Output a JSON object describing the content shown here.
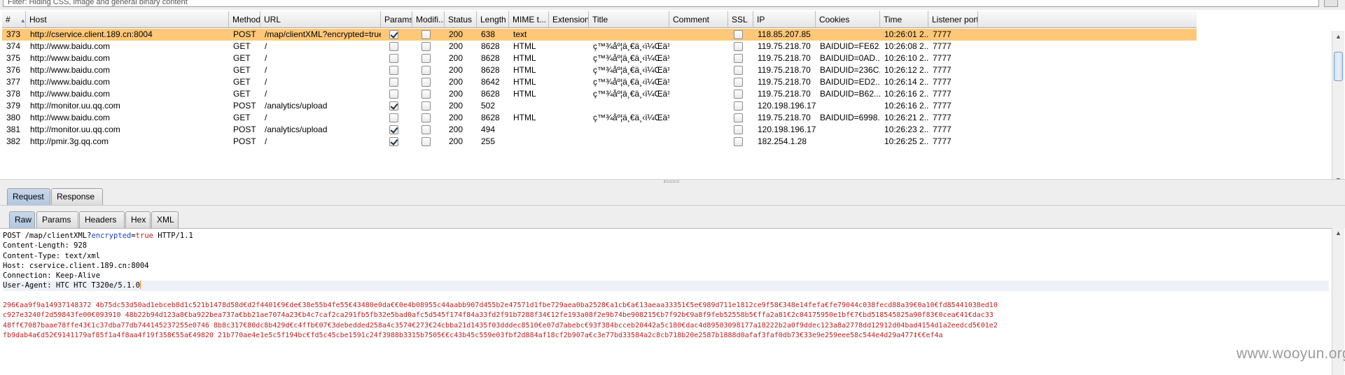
{
  "filter": {
    "text": "Filter: Hiding CSS, image and general binary content"
  },
  "columns": [
    {
      "key": "num",
      "label": "#"
    },
    {
      "key": "host",
      "label": "Host"
    },
    {
      "key": "method",
      "label": "Method"
    },
    {
      "key": "url",
      "label": "URL"
    },
    {
      "key": "params",
      "label": "Params"
    },
    {
      "key": "modified",
      "label": "Modifi..."
    },
    {
      "key": "status",
      "label": "Status"
    },
    {
      "key": "length",
      "label": "Length"
    },
    {
      "key": "mime",
      "label": "MIME t..."
    },
    {
      "key": "extension",
      "label": "Extension"
    },
    {
      "key": "title",
      "label": "Title"
    },
    {
      "key": "comment",
      "label": "Comment"
    },
    {
      "key": "ssl",
      "label": "SSL"
    },
    {
      "key": "ip",
      "label": "IP"
    },
    {
      "key": "cookies",
      "label": "Cookies"
    },
    {
      "key": "time",
      "label": "Time"
    },
    {
      "key": "port",
      "label": "Listener port"
    }
  ],
  "rows": [
    {
      "num": "373",
      "host": "http://cservice.client.189.cn:8004",
      "method": "POST",
      "url": "/map/clientXML?encrypted=true",
      "params": true,
      "modified": false,
      "status": "200",
      "length": "638",
      "mime": "text",
      "extension": "",
      "title": "",
      "comment": "",
      "ssl": false,
      "ip": "118.85.207.85",
      "cookies": "",
      "time": "10:26:01 2...",
      "port": "7777",
      "selected": true
    },
    {
      "num": "374",
      "host": "http://www.baidu.com",
      "method": "GET",
      "url": "/",
      "params": false,
      "modified": false,
      "status": "200",
      "length": "8628",
      "mime": "HTML",
      "extension": "",
      "title": "ç™¾åº¦ä¸€ä¸‹ï¼Œä½ å°±...",
      "comment": "",
      "ssl": false,
      "ip": "119.75.218.70",
      "cookies": "BAIDUID=FE62...",
      "time": "10:26:08 2...",
      "port": "7777",
      "selected": false
    },
    {
      "num": "375",
      "host": "http://www.baidu.com",
      "method": "GET",
      "url": "/",
      "params": false,
      "modified": false,
      "status": "200",
      "length": "8628",
      "mime": "HTML",
      "extension": "",
      "title": "ç™¾åº¦ä¸€ä¸‹ï¼Œä½ å°±...",
      "comment": "",
      "ssl": false,
      "ip": "119.75.218.70",
      "cookies": "BAIDUID=0AD...",
      "time": "10:26:10 2...",
      "port": "7777",
      "selected": false
    },
    {
      "num": "376",
      "host": "http://www.baidu.com",
      "method": "GET",
      "url": "/",
      "params": false,
      "modified": false,
      "status": "200",
      "length": "8628",
      "mime": "HTML",
      "extension": "",
      "title": "ç™¾åº¦ä¸€ä¸‹ï¼Œä½ å°±...",
      "comment": "",
      "ssl": false,
      "ip": "119.75.218.70",
      "cookies": "BAIDUID=236C...",
      "time": "10:26:12 2...",
      "port": "7777",
      "selected": false
    },
    {
      "num": "377",
      "host": "http://www.baidu.com",
      "method": "GET",
      "url": "/",
      "params": false,
      "modified": false,
      "status": "200",
      "length": "8642",
      "mime": "HTML",
      "extension": "",
      "title": "ç™¾åº¦ä¸€ä¸‹ï¼Œä½ å°±...",
      "comment": "",
      "ssl": false,
      "ip": "119.75.218.70",
      "cookies": "BAIDUID=ED2...",
      "time": "10:26:14 2...",
      "port": "7777",
      "selected": false
    },
    {
      "num": "378",
      "host": "http://www.baidu.com",
      "method": "GET",
      "url": "/",
      "params": false,
      "modified": false,
      "status": "200",
      "length": "8628",
      "mime": "HTML",
      "extension": "",
      "title": "ç™¾åº¦ä¸€ä¸‹ï¼Œä½ å°±...",
      "comment": "",
      "ssl": false,
      "ip": "119.75.218.70",
      "cookies": "BAIDUID=B62...",
      "time": "10:26:16 2...",
      "port": "7777",
      "selected": false
    },
    {
      "num": "379",
      "host": "http://monitor.uu.qq.com",
      "method": "POST",
      "url": "/analytics/upload",
      "params": true,
      "modified": false,
      "status": "200",
      "length": "502",
      "mime": "",
      "extension": "",
      "title": "",
      "comment": "",
      "ssl": false,
      "ip": "120.198.196.17",
      "cookies": "",
      "time": "10:26:16 2...",
      "port": "7777",
      "selected": false
    },
    {
      "num": "380",
      "host": "http://www.baidu.com",
      "method": "GET",
      "url": "/",
      "params": false,
      "modified": false,
      "status": "200",
      "length": "8628",
      "mime": "HTML",
      "extension": "",
      "title": "ç™¾åº¦ä¸€ä¸‹ï¼Œä½ å°±...",
      "comment": "",
      "ssl": false,
      "ip": "119.75.218.70",
      "cookies": "BAIDUID=6998...",
      "time": "10:26:21 2...",
      "port": "7777",
      "selected": false
    },
    {
      "num": "381",
      "host": "http://monitor.uu.qq.com",
      "method": "POST",
      "url": "/analytics/upload",
      "params": true,
      "modified": false,
      "status": "200",
      "length": "494",
      "mime": "",
      "extension": "",
      "title": "",
      "comment": "",
      "ssl": false,
      "ip": "120.198.196.17",
      "cookies": "",
      "time": "10:26:23 2...",
      "port": "7777",
      "selected": false
    },
    {
      "num": "382",
      "host": "http://pmir.3g.qq.com",
      "method": "POST",
      "url": "/",
      "params": true,
      "modified": false,
      "status": "200",
      "length": "255",
      "mime": "",
      "extension": "",
      "title": "",
      "comment": "",
      "ssl": false,
      "ip": "182.254.1.28",
      "cookies": "",
      "time": "10:26:25 2...",
      "port": "7777",
      "selected": false
    }
  ],
  "tabs_main": [
    "Request",
    "Response"
  ],
  "tabs_sub": [
    "Raw",
    "Params",
    "Headers",
    "Hex",
    "XML"
  ],
  "request": {
    "line1_pre": "POST /map/clientXML?",
    "line1_param": "encrypted",
    "line1_eq": "=",
    "line1_val": "true",
    "line1_post": " HTTP/1.1",
    "headers": [
      "Content-Length: 928",
      "Content-Type: text/xml",
      "Host: cservice.client.189.cn:8004",
      "Connection: Keep-Alive",
      "User-Agent: HTC HTC T320e/5.1.0"
    ],
    "body_lines": [
      "296€aa9f9a14937148372 4b75dc53d50ad1ebceb8d1c521b1478d58d€d2f4401€9€de€38e55b4fe55€43480e0da€€0e4b08955c44aabb907d455b2e47571d1fbe729aea0ba2528€a1cb€a€13aeaa33351€5e€989d711e1812ce9f58€348e14fefa€fe79044c038fecd88a39€0a10€fd85441038ed10",
      "c927e3240f2d59843fe00€093910 48b22b94d123a8€ba922bea737a€bb21ae7074a23€b4c7caf2ca291fb5fb32e5bad0afc5d545f174f84a33fd2f91b7288f34€12fe193a08f2e9b74be908215€b7f92b€9a8f9feb52558b5€ffa2a81€2c04175950e1bf€7€bd518545825a90f83€0cea€41€dac33",
      "48ff€7087baae78ffe43€1c37dba77db744145237255e0746 8b8c317€80dc8b429d€c4ffb€07€3debedded258a4c3574€273€24cbba21d1435f03dddec8510€e07d7abebc€93f384bcceb20442a5c180€dac4d89503098177a18222b2a0f9ddec123a8a2778dd12912d04bad4154d1a2eedcd5€01e2",
      "fb9dab4a€d52€9141179af85f1a4f8aa4f19f358€55a€49820 21b770ae4e1e5c5f194bc€fd5c45cbe1591c24f3988b3315b7505€€c43b45c559e03fbf2d884af18cf2b907a€c3e77bd33584a2c8cb718b20e2587b1888d0afaf3faf0db73€33e9e259eee58c544e4d29a477‡€€ef4a"
    ]
  },
  "watermark": "www.wooyun.org",
  "colors": {
    "selected_row": "#ffc878",
    "header_bg": "#e6e6e6",
    "param_name": "#2040c8",
    "param_value": "#c02020",
    "body_text": "#c02020"
  }
}
